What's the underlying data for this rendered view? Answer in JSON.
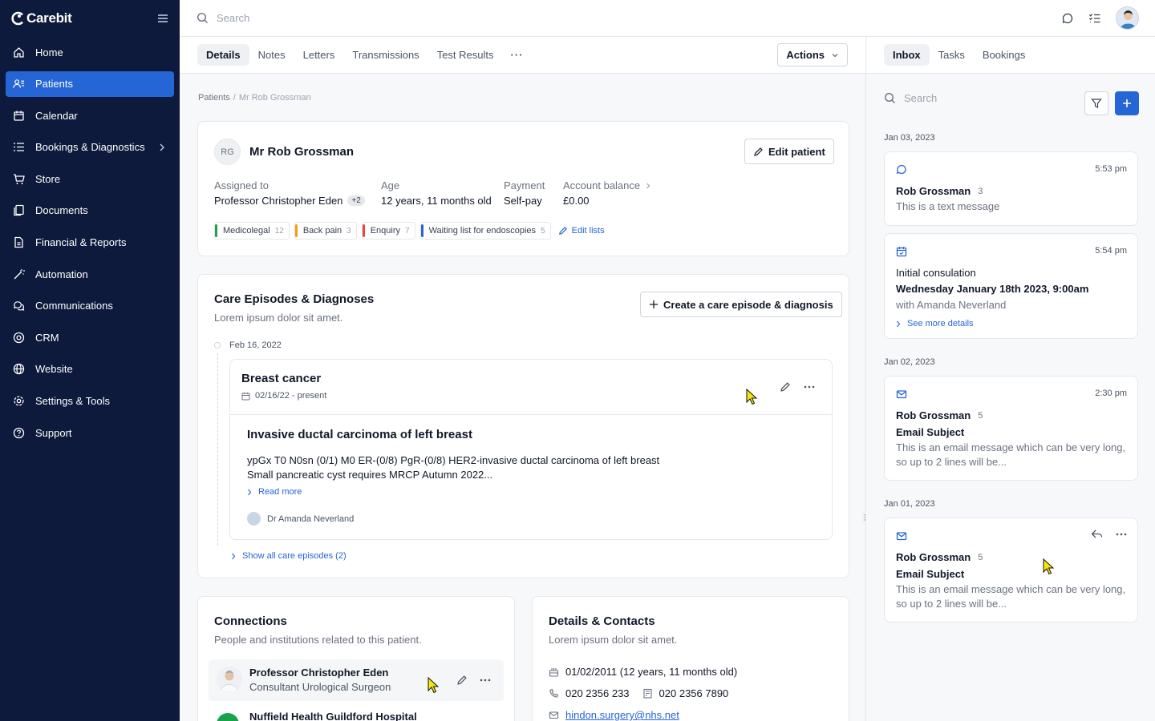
{
  "app": {
    "name": "Carebit"
  },
  "sidebar": {
    "items": [
      {
        "label": "Home",
        "icon": "home-icon"
      },
      {
        "label": "Patients",
        "icon": "patients-icon",
        "active": true
      },
      {
        "label": "Calendar",
        "icon": "calendar-icon"
      },
      {
        "label": "Bookings & Diagnostics",
        "icon": "list-icon",
        "has_children": true
      },
      {
        "label": "Store",
        "icon": "cart-icon"
      },
      {
        "label": "Documents",
        "icon": "documents-icon"
      },
      {
        "label": "Financial & Reports",
        "icon": "report-icon"
      },
      {
        "label": "Automation",
        "icon": "wand-icon"
      },
      {
        "label": "Communications",
        "icon": "chat-icon"
      },
      {
        "label": "CRM",
        "icon": "crm-icon"
      },
      {
        "label": "Website",
        "icon": "globe-icon"
      },
      {
        "label": "Settings & Tools",
        "icon": "gear-icon"
      },
      {
        "label": "Support",
        "icon": "help-icon"
      }
    ]
  },
  "topbar": {
    "search_placeholder": "Search"
  },
  "main": {
    "tabs": [
      "Details",
      "Notes",
      "Letters",
      "Transmissions",
      "Test Results"
    ],
    "active_tab": "Details",
    "more": "···",
    "actions_label": "Actions",
    "breadcrumb": {
      "root": "Patients",
      "separator": "/",
      "current": "Mr Rob Grossman"
    }
  },
  "patient": {
    "initials": "RG",
    "name": "Mr Rob Grossman",
    "edit_label": "Edit patient",
    "assigned_label": "Assigned to",
    "assigned_value": "Professor Christopher Eden",
    "assigned_extra": "+2",
    "age_label": "Age",
    "age_value": "12 years, 11 months old",
    "payment_label": "Payment",
    "payment_value": "Self-pay",
    "balance_label": "Account balance",
    "balance_value": "£0.00",
    "tags": [
      {
        "label": "Medicolegal",
        "count": "12",
        "color": "#16a34a"
      },
      {
        "label": "Back pain",
        "count": "3",
        "color": "#f59e0b"
      },
      {
        "label": "Enquiry",
        "count": "7",
        "color": "#ef4444"
      },
      {
        "label": "Waiting list for endoscopies",
        "count": "5",
        "color": "#2565d6"
      }
    ],
    "edit_lists_label": "Edit lists"
  },
  "care": {
    "title": "Care Episodes & Diagnoses",
    "subtitle": "Lorem ipsum dolor sit amet.",
    "create_label": "Create a care episode & diagnosis",
    "date": "Feb 16, 2022",
    "episode": {
      "title": "Breast cancer",
      "range": "02/16/22 - present",
      "diagnosis": "Invasive ductal carcinoma of left breast",
      "line1": "ypGx T0 N0sn (0/1) M0 ER-(0/8) PgR-(0/8) HER2-invasive ductal carcinoma of left breast",
      "line2": "Small pancreatic cyst requires MRCP Autumn 2022...",
      "read_more": "Read more",
      "doctor": "Dr Amanda Neverland"
    },
    "show_all": "Show all care episodes (2)"
  },
  "connections": {
    "title": "Connections",
    "subtitle": "People and institutions related to this patient.",
    "items": [
      {
        "name": "Professor Christopher Eden",
        "role": "Consultant Urological Surgeon"
      },
      {
        "name": "Nuffield Health Guildford Hospital"
      }
    ]
  },
  "details": {
    "title": "Details & Contacts",
    "subtitle": "Lorem ipsum dolor sit amet.",
    "dob": "01/02/2011 (12 years, 11 months old)",
    "phone": "020 2356 233",
    "fax": "020 2356 7890",
    "email": "hindon.surgery@nhs.net"
  },
  "inbox": {
    "tabs": [
      "Inbox",
      "Tasks",
      "Bookings"
    ],
    "active_tab": "Inbox",
    "search_placeholder": "Search",
    "groups": [
      {
        "date": "Jan 03, 2023"
      },
      {
        "date": "Jan 02, 2023"
      },
      {
        "date": "Jan 01, 2023"
      }
    ],
    "messages": [
      {
        "type": "sms",
        "time": "5:53 pm",
        "sender": "Rob Grossman",
        "count": "3",
        "text": "This is a text message"
      },
      {
        "type": "booking",
        "time": "5:54 pm",
        "title": "Initial consulation",
        "when": "Wednesday January 18th 2023, 9:00am",
        "with": "with Amanda Neverland",
        "see_more": "See more details"
      },
      {
        "type": "email",
        "time": "2:30 pm",
        "sender": "Rob Grossman",
        "count": "5",
        "subject": "Email Subject",
        "text": "This is an email message which can be very long, so up to 2 lines will be..."
      },
      {
        "type": "email",
        "sender": "Rob Grossman",
        "count": "5",
        "subject": "Email Subject",
        "text": "This is an email message which can be very long, so up to 2 lines will be..."
      }
    ]
  },
  "colors": {
    "sidebar_bg": "#0e1a3b",
    "accent": "#2565d6",
    "cursor": "#f5e50a"
  }
}
